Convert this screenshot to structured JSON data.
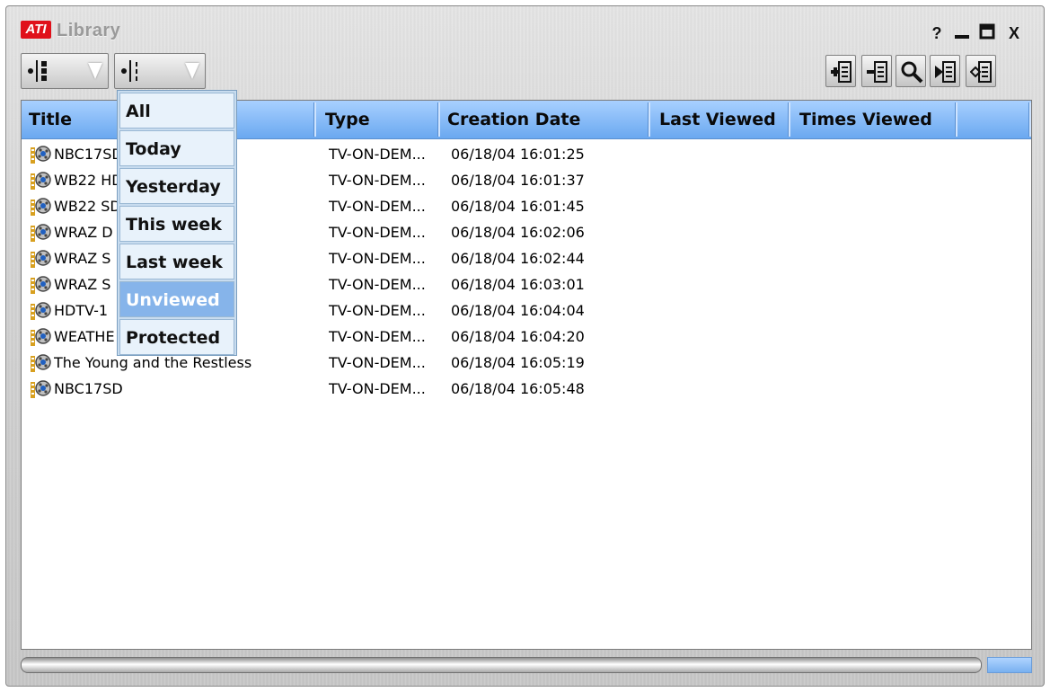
{
  "window": {
    "title": "Library",
    "logo_text": "ATI",
    "controls": {
      "help": "?",
      "minimize": "_",
      "maximize": "□",
      "close": "X"
    }
  },
  "toolbar": {
    "left_selectors": [
      "sort-order-icon",
      "numbered-list-icon"
    ],
    "right_buttons": [
      "add-to-list-icon",
      "remove-from-list-icon",
      "search-icon",
      "play-list-icon",
      "properties-icon"
    ]
  },
  "table": {
    "columns": [
      "Title",
      "Type",
      "Creation Date",
      "Last Viewed",
      "Times Viewed"
    ],
    "rows": [
      {
        "title": "NBC17SD",
        "type": "TV-ON-DEM...",
        "created": "06/18/04 16:01:25"
      },
      {
        "title": "WB22 HD",
        "type": "TV-ON-DEM...",
        "created": "06/18/04 16:01:37"
      },
      {
        "title": "WB22 SD",
        "type": "TV-ON-DEM...",
        "created": "06/18/04 16:01:45"
      },
      {
        "title": "WRAZ D",
        "type": "TV-ON-DEM...",
        "created": "06/18/04 16:02:06"
      },
      {
        "title": "WRAZ S",
        "type": "TV-ON-DEM...",
        "created": "06/18/04 16:02:44"
      },
      {
        "title": "WRAZ S",
        "type": "TV-ON-DEM...",
        "created": "06/18/04 16:03:01"
      },
      {
        "title": "HDTV-1",
        "type": "TV-ON-DEM...",
        "created": "06/18/04 16:04:04"
      },
      {
        "title": "WEATHE",
        "type": "TV-ON-DEM...",
        "created": "06/18/04 16:04:20"
      },
      {
        "title": "The Young and the Restless",
        "type": "TV-ON-DEM...",
        "created": "06/18/04 16:05:19"
      },
      {
        "title": "NBC17SD",
        "type": "TV-ON-DEM...",
        "created": "06/18/04 16:05:48"
      }
    ]
  },
  "filter_menu": {
    "items": [
      "All",
      "Today",
      "Yesterday",
      "This week",
      "Last week",
      "Unviewed",
      "Protected"
    ],
    "selected": "Unviewed"
  },
  "colors": {
    "header_blue": "#6aa8f0",
    "menu_selected": "#86b4ea",
    "logo_red": "#e0101a"
  }
}
